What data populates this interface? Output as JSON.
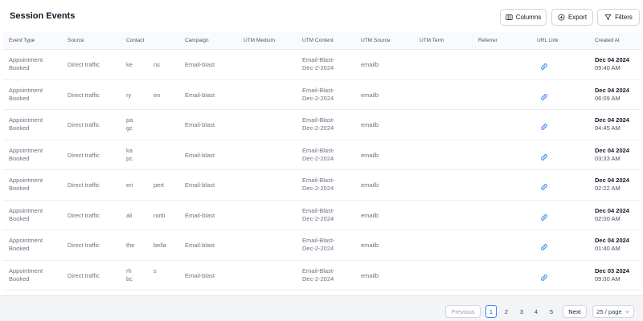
{
  "header": {
    "title": "Session Events",
    "columns_label": "Columns",
    "export_label": "Export",
    "filters_label": "Filters"
  },
  "table": {
    "columns": [
      "Event Type",
      "Source",
      "Contact",
      "Campaign",
      "UTM Medium",
      "UTM Content",
      "UTM Source",
      "UTM Term",
      "Referrer",
      "URL Link",
      "Created At"
    ],
    "rows": [
      {
        "event_line1": "Appointment",
        "event_line2": "Booked",
        "source": "Direct traffic",
        "contact_line1": "ke",
        "contact_line2": "",
        "contact_extra": "ns",
        "campaign": "Email-blast",
        "utm_medium": "",
        "utm_content_line1": "Email-Blast-",
        "utm_content_line2": "Dec-2-2024",
        "utm_source": "emailb",
        "utm_term": "",
        "referrer": "",
        "created_date": "Dec 04 2024",
        "created_time": "09:40 AM"
      },
      {
        "event_line1": "Appointment",
        "event_line2": "Booked",
        "source": "Direct traffic",
        "contact_line1": "ry",
        "contact_line2": "",
        "contact_extra": "en",
        "campaign": "Email-blast",
        "utm_medium": "",
        "utm_content_line1": "Email-Blast-",
        "utm_content_line2": "Dec-2-2024",
        "utm_source": "emailb",
        "utm_term": "",
        "referrer": "",
        "created_date": "Dec 04 2024",
        "created_time": "06:09 AM"
      },
      {
        "event_line1": "Appointment",
        "event_line2": "Booked",
        "source": "Direct traffic",
        "contact_line1": "pa",
        "contact_line2": "gc",
        "contact_extra": "",
        "campaign": "Email-blast",
        "utm_medium": "",
        "utm_content_line1": "Email-Blast-",
        "utm_content_line2": "Dec-2-2024",
        "utm_source": "emailb",
        "utm_term": "",
        "referrer": "",
        "created_date": "Dec 04 2024",
        "created_time": "04:45 AM"
      },
      {
        "event_line1": "Appointment",
        "event_line2": "Booked",
        "source": "Direct traffic",
        "contact_line1": "ka",
        "contact_line2": "pc",
        "contact_extra": "",
        "campaign": "Email-blast",
        "utm_medium": "",
        "utm_content_line1": "Email-Blast-",
        "utm_content_line2": "Dec-2-2024",
        "utm_source": "emailb",
        "utm_term": "",
        "referrer": "",
        "created_date": "Dec 04 2024",
        "created_time": "03:33 AM"
      },
      {
        "event_line1": "Appointment",
        "event_line2": "Booked",
        "source": "Direct traffic",
        "contact_line1": "eri",
        "contact_line2": "",
        "contact_extra": "pert",
        "campaign": "Email-blast",
        "utm_medium": "",
        "utm_content_line1": "Email-Blast-",
        "utm_content_line2": "Dec-2-2024",
        "utm_source": "emailb",
        "utm_term": "",
        "referrer": "",
        "created_date": "Dec 04 2024",
        "created_time": "02:22 AM"
      },
      {
        "event_line1": "Appointment",
        "event_line2": "Booked",
        "source": "Direct traffic",
        "contact_line1": "ali",
        "contact_line2": "",
        "contact_extra": "notti",
        "campaign": "Email-blast",
        "utm_medium": "",
        "utm_content_line1": "Email-Blast-",
        "utm_content_line2": "Dec-2-2024",
        "utm_source": "emailb",
        "utm_term": "",
        "referrer": "",
        "created_date": "Dec 04 2024",
        "created_time": "02:00 AM"
      },
      {
        "event_line1": "Appointment",
        "event_line2": "Booked",
        "source": "Direct traffic",
        "contact_line1": "the",
        "contact_line2": "",
        "contact_extra": "bella",
        "campaign": "Email-blast",
        "utm_medium": "",
        "utm_content_line1": "Email-Blast-",
        "utm_content_line2": "Dec-2-2024",
        "utm_source": "emailb",
        "utm_term": "",
        "referrer": "",
        "created_date": "Dec 04 2024",
        "created_time": "01:40 AM"
      },
      {
        "event_line1": "Appointment",
        "event_line2": "Booked",
        "source": "Direct traffic",
        "contact_line1": "rh",
        "contact_line2": "bc",
        "contact_extra": "s",
        "campaign": "Email-blast",
        "utm_medium": "",
        "utm_content_line1": "Email-Blast-",
        "utm_content_line2": "Dec-2-2024",
        "utm_source": "emailb",
        "utm_term": "",
        "referrer": "",
        "created_date": "Dec 03 2024",
        "created_time": "09:00 AM"
      }
    ]
  },
  "pagination": {
    "previous_label": "Previous",
    "pages": [
      "1",
      "2",
      "3",
      "4",
      "5"
    ],
    "current_page": "1",
    "next_label": "Next",
    "page_size_label": "25 / page"
  },
  "colors": {
    "link_icon": "#3b82f6",
    "active_page": "#2563eb"
  }
}
